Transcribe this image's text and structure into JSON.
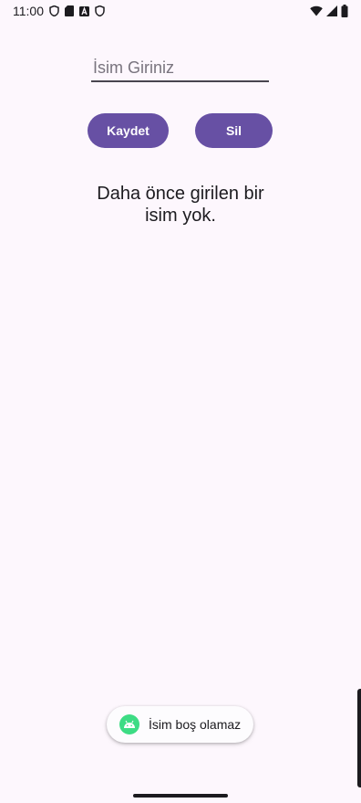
{
  "status_bar": {
    "time": "11:00",
    "left_icons": [
      "shield-icon",
      "sd-card-icon",
      "font-a-icon",
      "shield-icon"
    ],
    "right_icons": [
      "wifi-icon",
      "signal-icon",
      "battery-icon"
    ]
  },
  "form": {
    "name_placeholder": "İsim Giriniz",
    "name_value": ""
  },
  "buttons": {
    "save_label": "Kaydet",
    "delete_label": "Sil"
  },
  "message": "Daha önce girilen bir isim yok.",
  "toast": {
    "text": "İsim boş olamaz",
    "icon": "android-icon"
  },
  "colors": {
    "background": "#fdf7fd",
    "primary": "#6750a4",
    "on_primary": "#ffffff",
    "android_green": "#3ddc84"
  }
}
